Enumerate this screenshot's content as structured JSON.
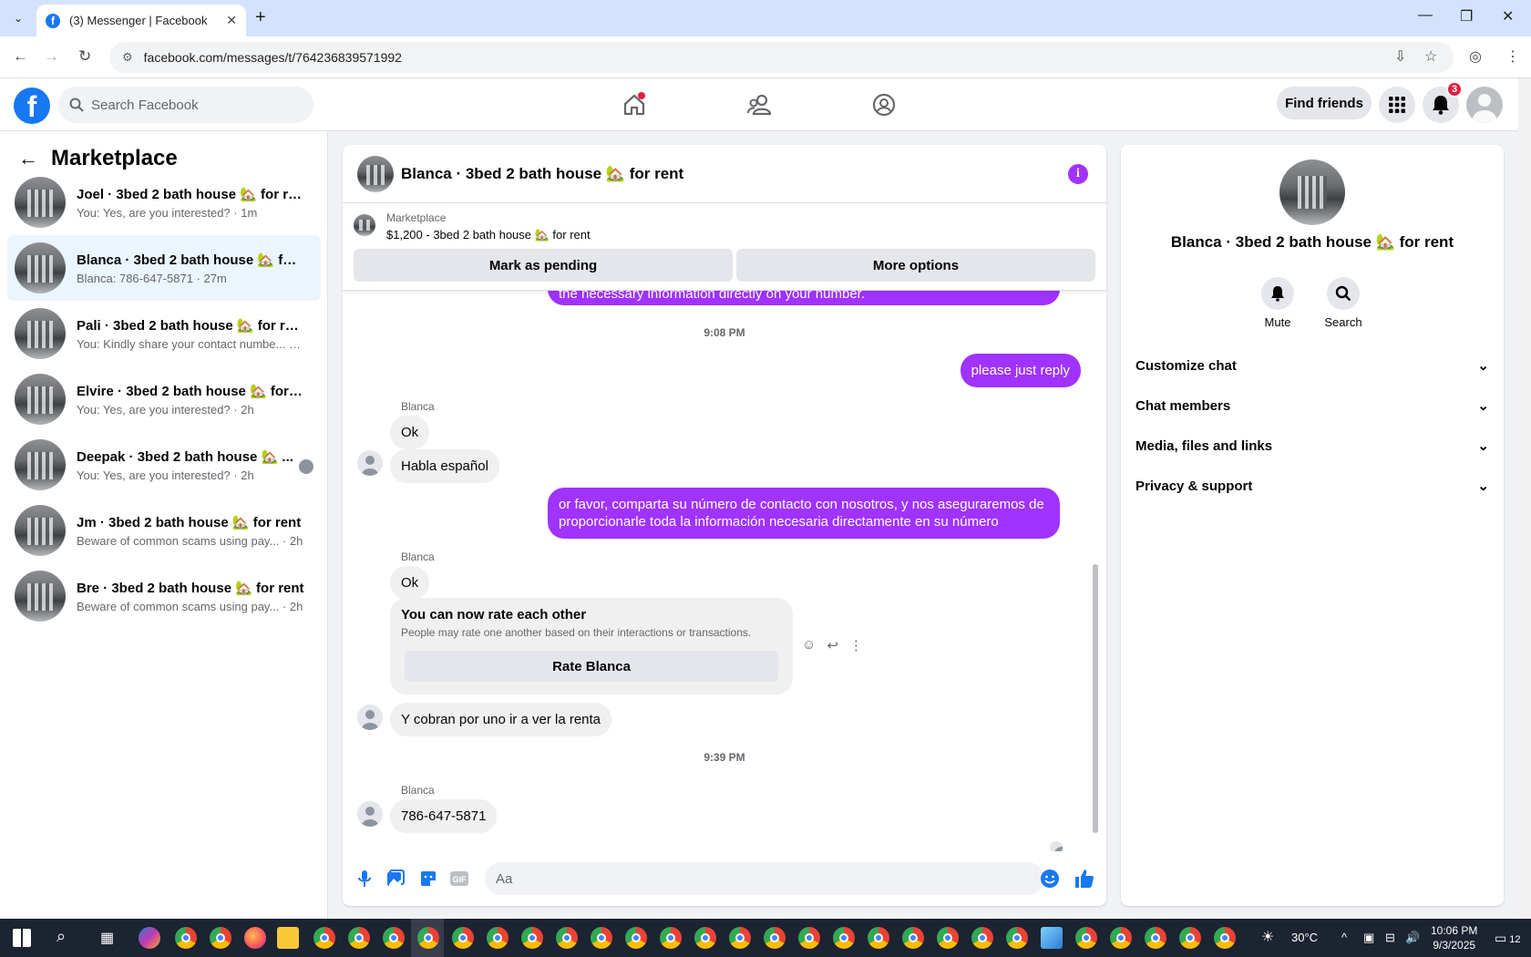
{
  "browser": {
    "tab_title": "(3) Messenger | Facebook",
    "url": "facebook.com/messages/t/764236839571992"
  },
  "header": {
    "search_placeholder": "Search Facebook",
    "find_friends": "Find friends",
    "notification_count": "3"
  },
  "sidebar": {
    "title": "Marketplace",
    "conversations": [
      {
        "name": "Joel · 3bed 2 bath house 🏡 for rent",
        "preview": "You: Yes, are you interested?",
        "time": "· 1m"
      },
      {
        "name": "Blanca · 3bed 2 bath house 🏡 for ...",
        "preview": "Blanca: 786-647-5871",
        "time": "· 27m"
      },
      {
        "name": "Pali · 3bed 2 bath house 🏡 for rent",
        "preview": "You: Kindly share your contact numbe...",
        "time": "· 2h"
      },
      {
        "name": "Elvire · 3bed 2 bath house 🏡 for r...",
        "preview": "You: Yes, are you interested?",
        "time": "· 2h"
      },
      {
        "name": "Deepak · 3bed 2 bath house 🏡 ...",
        "preview": "You: Yes, are you interested?",
        "time": "· 2h"
      },
      {
        "name": "Jm · 3bed 2 bath house 🏡 for rent",
        "preview": "Beware of common scams using pay...",
        "time": "· 2h"
      },
      {
        "name": "Bre · 3bed 2 bath house 🏡 for rent",
        "preview": "Beware of common scams using pay...",
        "time": "· 2h"
      }
    ]
  },
  "chat": {
    "title": "Blanca · 3bed 2 bath house 🏡 for rent",
    "marketplace_label": "Marketplace",
    "listing": "$1,200 - 3bed 2 bath house 🏡 for rent",
    "mark_pending": "Mark as pending",
    "more_options": "More options",
    "cut_message": "the necessary information directly on your number.",
    "time_1": "9:08 PM",
    "msg_out_1": "please just reply",
    "sender_1": "Blanca",
    "msg_in_1": "Ok",
    "msg_in_2": "Habla español",
    "msg_out_2": "or favor, comparta su número de contacto con nosotros, y nos aseguraremos de proporcionarle toda la información necesaria directamente en su número",
    "sender_2": "Blanca",
    "msg_in_3": "Ok",
    "rate_title": "You can now rate each other",
    "rate_sub": "People may rate one another based on their interactions or transactions.",
    "rate_button": "Rate Blanca",
    "msg_in_4": "Y cobran por uno ir a ver la renta",
    "time_2": "9:39 PM",
    "sender_3": "Blanca",
    "msg_in_5": "786-647-5871",
    "composer_placeholder": "Aa"
  },
  "details": {
    "name": "Blanca · 3bed 2 bath house 🏡 for rent",
    "mute": "Mute",
    "search": "Search",
    "sections": [
      "Customize chat",
      "Chat members",
      "Media, files and links",
      "Privacy & support"
    ]
  },
  "taskbar": {
    "temperature": "30°C",
    "time": "10:06 PM",
    "date": "9/3/2025",
    "notif_count": "12"
  },
  "colors": {
    "accent": "#a033ff",
    "fb_blue": "#1877f2"
  }
}
